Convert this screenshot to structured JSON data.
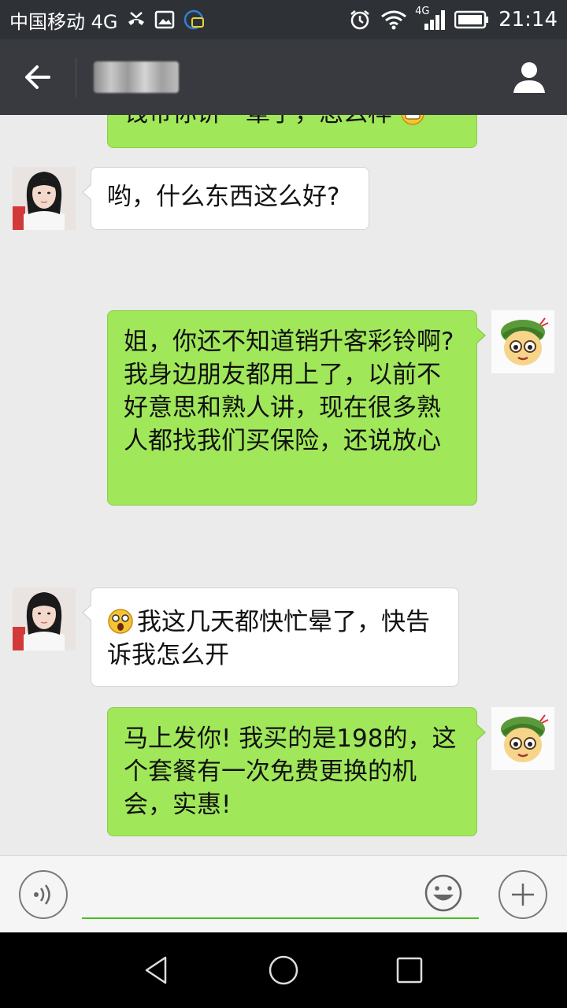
{
  "status_bar": {
    "carrier": "中国移动 4G",
    "network_badge": "4G",
    "time": "21:14",
    "icons": [
      "missed-call-icon",
      "image-icon",
      "app-notification-icon",
      "alarm-icon",
      "wifi-icon",
      "signal-icon",
      "battery-icon"
    ]
  },
  "header": {
    "back_icon": "arrow-left-icon",
    "title": "",
    "profile_icon": "person-icon"
  },
  "messages": [
    {
      "side": "right",
      "text": "钱带你讲一辈子，怎么样",
      "partial": true,
      "trailing_emoji": "grin-emoji"
    },
    {
      "side": "left",
      "text": "哟，什么东西这么好?"
    },
    {
      "side": "right",
      "text": "姐，你还不知道销升客彩铃啊? 我身边朋友都用上了，以前不好意思和熟人讲，现在很多熟人都找我们买保险，还说放心"
    },
    {
      "side": "left",
      "text": "我这几天都快忙晕了，快告诉我怎么开",
      "leading_emoji": "dizzy-emoji"
    },
    {
      "side": "right",
      "text": "马上发你! 我买的是198的，这个套餐有一次免费更换的机会，实惠!"
    }
  ],
  "input_bar": {
    "voice_icon": "voice-icon",
    "placeholder": "",
    "emoji_icon": "smiley-icon",
    "more_icon": "plus-icon"
  },
  "nav_bar": {
    "icons": [
      "back-triangle-icon",
      "home-circle-icon",
      "recents-square-icon"
    ]
  },
  "colors": {
    "status_bar_bg": "#2e3237",
    "title_bar_bg": "#393a3f",
    "chat_bg": "#ebebeb",
    "outgoing_bubble": "#a0e75a",
    "incoming_bubble": "#ffffff",
    "input_underline": "#45c01a"
  }
}
